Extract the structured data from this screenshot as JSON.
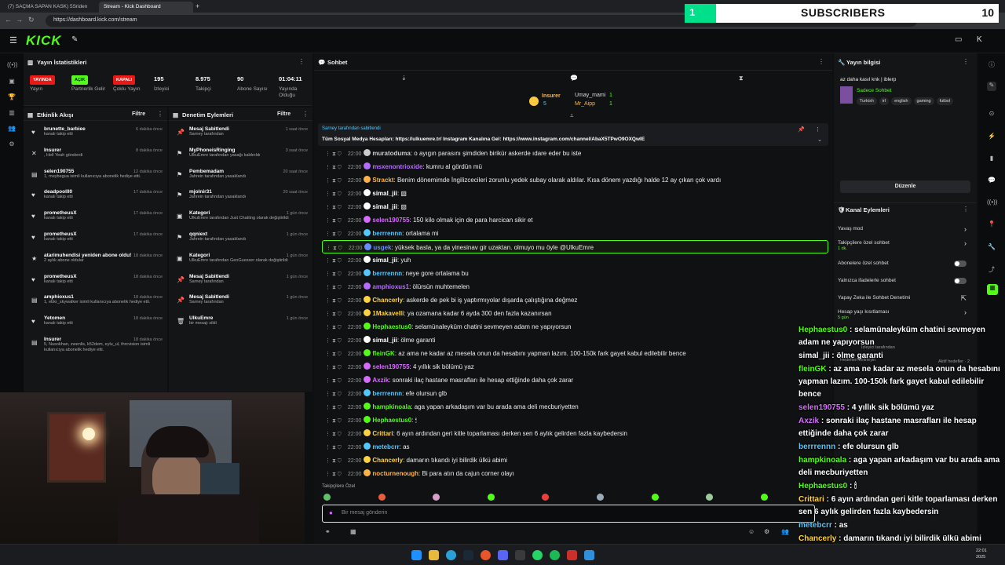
{
  "browser": {
    "tabs": [
      {
        "title": "(7) SAÇMA SAPAN KASK) 5Sriden"
      },
      {
        "title": "Stream - Kick Dashboard"
      }
    ],
    "url": "https://dashboard.kick.com/stream"
  },
  "header": {
    "logo": "KICK"
  },
  "stats": {
    "title": "Yayın İstatistikleri",
    "items": [
      {
        "value": "YAYINDA",
        "label": "Yayın",
        "color": "#e91916"
      },
      {
        "value": "AÇIK",
        "label": "Partnerlik Gelir",
        "color": "#53fc18"
      },
      {
        "value": "KAPALI",
        "label": "Çoklu Yayın",
        "color": "#e91916"
      },
      {
        "value": "195",
        "label": "İzleyici"
      },
      {
        "value": "8.975",
        "label": "Takipçi"
      },
      {
        "value": "90",
        "label": "Abone Sayısı"
      },
      {
        "value": "01:04:11",
        "label": "Yayında Olduğu"
      }
    ]
  },
  "activity": {
    "title": "Etkinlik Akışı",
    "filter": "Filtre",
    "items": [
      {
        "icon": "♥",
        "name": "brunette_barbiee",
        "desc": "kanalı takip etti",
        "time": "6 dakika önce"
      },
      {
        "icon": "✕",
        "name": "Insurer",
        "desc": ", Hell Yeah gönderdi",
        "time": "8 dakika önce"
      },
      {
        "icon": "▤",
        "name": "selen190755",
        "desc": "1, meybegua isimli kullanıcıya abonelik hediye etti.",
        "time": "12 dakika önce"
      },
      {
        "icon": "♥",
        "name": "deadpoolll0",
        "desc": "kanalı takip etti",
        "time": "17 dakika önce"
      },
      {
        "icon": "♥",
        "name": "prometheusX",
        "desc": "kanalı takip etti",
        "time": "17 dakika önce"
      },
      {
        "icon": "♥",
        "name": "prometheusX",
        "desc": "kanalı takip etti",
        "time": "17 dakika önce"
      },
      {
        "icon": "★",
        "name": "atarimuhendisi yeniden abone oldu!",
        "desc": "2 aylık abone oldular",
        "time": "18 dakika önce"
      },
      {
        "icon": "♥",
        "name": "prometheusX",
        "desc": "kanalı takip etti",
        "time": "18 dakika önce"
      },
      {
        "icon": "▤",
        "name": "amphioxus1",
        "desc": "1, ebkr_skywalker isimli kullanıcıya abonelik hediye etti.",
        "time": "18 dakika önce"
      },
      {
        "icon": "♥",
        "name": "Yetomen",
        "desc": "kanalı takip etti",
        "time": "18 dakika önce"
      },
      {
        "icon": "▤",
        "name": "Insurer",
        "desc": "5, Nusokhan, zwenlis, k52dem, eylu_ul, thrcvision isimli kullanıcıya abonelik hediye etti.",
        "time": "18 dakika önce"
      }
    ]
  },
  "moderation": {
    "title": "Denetim Eylemleri",
    "filter": "Filtre",
    "items": [
      {
        "icon": "📌",
        "name": "Mesaj Sabitlendi",
        "desc": "Sarney tarafından",
        "time": "1 saat önce"
      },
      {
        "icon": "⚑",
        "name": "MyPhoneisRinging",
        "desc": "UlkuEmre tarafından yasağı kaldırıldı",
        "time": "3 saat önce"
      },
      {
        "icon": "⚑",
        "name": "Pembemadam",
        "desc": "Jahrein tarafından yasaklandı",
        "time": "20 saat önce"
      },
      {
        "icon": "⚑",
        "name": "mjolnir31",
        "desc": "Jahrein tarafından yasaklandı",
        "time": "20 saat önce"
      },
      {
        "icon": "▣",
        "name": "Kategori",
        "desc": "UlkuEmre tarafından Just Chatting olarak değiştirildi",
        "time": "1 gün önce"
      },
      {
        "icon": "⚑",
        "name": "qqniext",
        "desc": "Jahrein tarafından yasaklandı",
        "time": "1 gün önce"
      },
      {
        "icon": "▣",
        "name": "Kategori",
        "desc": "UlkuEmre tarafından GeoGuesser olarak değiştirildi",
        "time": "1 gün önce"
      },
      {
        "icon": "📌",
        "name": "Mesaj Sabitlendi",
        "desc": "Sarney tarafından",
        "time": "1 gün önce"
      },
      {
        "icon": "📌",
        "name": "Mesaj Sabitlendi",
        "desc": "Sarney tarafından",
        "time": "1 gün önce"
      },
      {
        "icon": "🗑",
        "name": "UlkuEmre",
        "desc": "bir mesajı sildi",
        "time": "1 gün önce"
      }
    ]
  },
  "chat": {
    "title": "Sohbet",
    "leaderboard": [
      {
        "name": "Insurer",
        "count": "5"
      },
      {
        "name": "Umay_mami",
        "count": "1"
      },
      {
        "name": "Mr_Aipp",
        "count": "1"
      }
    ],
    "pinned": {
      "by": "Sarney tarafından sabitlendi",
      "text": "Tüm Sosyal Medya Hesapları: https://ulkuemre.tr/ Instagram Kanalına Gel: https://www.instagram.com/channel/AbaX5TPwO9OXQwIE"
    },
    "messages": [
      {
        "t": "22:00",
        "u": "muratoduma",
        "c": "#ccc",
        "m": "o ayıgın parasını şimdiden birikür askerde ıdare eder bu iste"
      },
      {
        "t": "22:00",
        "u": "msxenontrioxide",
        "c": "#b46bff",
        "m": "kumru al gördün mü"
      },
      {
        "t": "22:00",
        "u": "Strackt",
        "c": "#ffb347",
        "m": "Benim dönemimde İngilizcecileri zorunlu yedek subay olarak aldılar. Kısa dönem yazdığı halde 12 ay çıkan çok vardı"
      },
      {
        "t": "22:00",
        "u": "simal_jii",
        "c": "#fff",
        "m": "▧"
      },
      {
        "t": "22:00",
        "u": "simal_jii",
        "c": "#fff",
        "m": "▧"
      },
      {
        "t": "22:00",
        "u": "selen190755",
        "c": "#d86bff",
        "m": "150 kilo olmak için de para harcican sikir et"
      },
      {
        "t": "22:00",
        "u": "berrrennn",
        "c": "#53c8ff",
        "m": "ortalama mi"
      },
      {
        "t": "22:00",
        "u": "usgek",
        "c": "#6b8cff",
        "m": "yüksek basla, ya da yinesinav gir uzaktan. olmuyo mu öyle @UlkuEmre",
        "hl": true
      },
      {
        "t": "22:00",
        "u": "simal_jii",
        "c": "#fff",
        "m": "yuh"
      },
      {
        "t": "22:00",
        "u": "berrrennn",
        "c": "#53c8ff",
        "m": "neye gore ortalama bu"
      },
      {
        "t": "22:00",
        "u": "amphioxus1",
        "c": "#b46bff",
        "m": "ölürsün muhtemelen"
      },
      {
        "t": "22:00",
        "u": "Chancerly",
        "c": "#ffd23f",
        "m": "askerde de pek bi iş yaptırmıyolar dışarda çalıştığına değmez"
      },
      {
        "t": "22:00",
        "u": "1Makavelli",
        "c": "#ffd23f",
        "m": "ya ozamana kadar 6 ayda 300 den fazla kazanırsan"
      },
      {
        "t": "22:00",
        "u": "Hephaestus0",
        "c": "#53fc18",
        "m": "selamünaleyküm chatini sevmeyen adam ne yapıyorsun"
      },
      {
        "t": "22:00",
        "u": "simal_jii",
        "c": "#fff",
        "m": "ölme garanti"
      },
      {
        "t": "22:00",
        "u": "fleinGK",
        "c": "#53fc18",
        "m": "az ama ne kadar az mesela onun da hesabını yapman lazım. 100-150k fark gayet kabul edilebilir bence"
      },
      {
        "t": "22:00",
        "u": "selen190755",
        "c": "#d86bff",
        "m": "4 yıllık sik bölümü yaz"
      },
      {
        "t": "22:00",
        "u": "Axzik",
        "c": "#d86bff",
        "m": "sonraki ilaç hastane masrafları ile hesap ettiğinde daha çok zarar"
      },
      {
        "t": "22:00",
        "u": "berrrennn",
        "c": "#53c8ff",
        "m": "efe olursun glb"
      },
      {
        "t": "22:00",
        "u": "hampkinoala",
        "c": "#53fc18",
        "m": "aga yapan arkadaşım var bu arada ama deli mecburiyetten"
      },
      {
        "t": "22:00",
        "u": "Hephaestus0",
        "c": "#53fc18",
        "m": "🕯"
      },
      {
        "t": "22:00",
        "u": "Crittari",
        "c": "#ffd23f",
        "m": "6 ayın ardından geri kitle toparlaması derken sen 6 aylık gelirden fazla kaybedersin"
      },
      {
        "t": "22:00",
        "u": "metebcrr",
        "c": "#53c8ff",
        "m": "as"
      },
      {
        "t": "22:00",
        "u": "Chancerly",
        "c": "#ffd23f",
        "m": "damarın tıkandı iyi bilirdik ülkü abimi"
      },
      {
        "t": "22:00",
        "u": "nocturnenough",
        "c": "#ffb347",
        "m": "Bi para atın da cajun corner olayı"
      }
    ],
    "followers_label": "Takipçilere Özel",
    "input_placeholder": "Bir mesaj gönderin",
    "send_label": "Sohbet"
  },
  "streamInfo": {
    "title": "Yayın bilgisi",
    "stream_title": "az daha kasıl knk | iblerp",
    "category": "Sadece Sohbet",
    "tags": [
      "Turkish",
      "irl",
      "english",
      "gaming",
      "futbol"
    ],
    "edit": "Düzenle"
  },
  "channelActions": {
    "title": "Kanal Eylemleri",
    "items": [
      {
        "label": "Yavaş mod"
      },
      {
        "label": "Takipçilere özel sohbet",
        "sub": "1 dk."
      },
      {
        "label": "Abonelere özel sohbet"
      },
      {
        "label": "Yalnızca ifadelerle sohbet"
      },
      {
        "label": "Yapay Zeka ile Sohbet Denetimi"
      },
      {
        "label": "Hesap yaşı kısıtlaması",
        "sub": "5 gün"
      }
    ],
    "hidden_partial": "Hedefleri belirleyin",
    "viewers_partial": "İzleyici tarafından",
    "goals_partial": "Aktif hedefler · 2"
  },
  "subscribers": {
    "label": "SUBSCRIBERS",
    "count": "10",
    "bar": "1",
    "progress": 0.1
  },
  "overlay": [
    {
      "u": "Hephaestus0",
      "c": "#53fc18",
      "m": "selamünaleyküm chatini sevmeyen adam ne yapıyorsun"
    },
    {
      "u": "simal_jii",
      "c": "#fff",
      "m": "ölme garanti"
    },
    {
      "u": "fleinGK",
      "c": "#53fc18",
      "m": "az ama ne kadar az mesela onun da hesabını yapman lazım. 100-150k fark gayet kabul edilebilir bence"
    },
    {
      "u": "selen190755",
      "c": "#d86bff",
      "m": "4 yıllık sik bölümü yaz"
    },
    {
      "u": "Axzik",
      "c": "#d86bff",
      "m": "sonraki ilaç hastane masrafları ile hesap ettiğinde daha çok zarar"
    },
    {
      "u": "berrrennn",
      "c": "#53c8ff",
      "m": "efe olursun glb"
    },
    {
      "u": "hampkinoala",
      "c": "#53fc18",
      "m": "aga yapan arkadaşım var bu arada ama deli mecburiyetten"
    },
    {
      "u": "Hephaestus0",
      "c": "#53fc18",
      "m": "🕯"
    },
    {
      "u": "Crittari",
      "c": "#ffd23f",
      "m": "6 ayın ardından geri kitle toparlaması derken sen 6 aylık gelirden fazla kaybedersin"
    },
    {
      "u": "metebcrr",
      "c": "#53c8ff",
      "m": "as"
    },
    {
      "u": "Chancerly",
      "c": "#ffd23f",
      "m": "damarın tıkandı iyi bilirdik ülkü abimi"
    },
    {
      "u": "nocturnenough",
      "c": "#ffb347",
      "m": "Bi para atın da cajun corner olayı"
    }
  ],
  "clock": {
    "time": "22:01",
    "date": "2025"
  },
  "colors": {
    "accent": "#53fc18",
    "live": "#e91916"
  }
}
